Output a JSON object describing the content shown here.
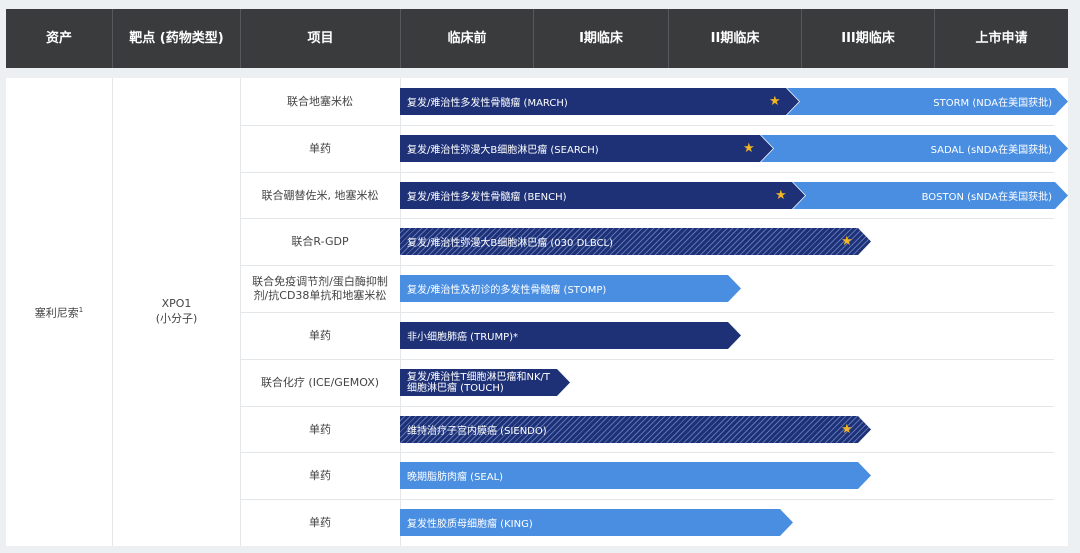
{
  "header": {
    "columns": [
      "资产",
      "靶点 (药物类型)",
      "项目",
      "临床前",
      "I期临床",
      "II期临床",
      "III期临床",
      "上市申请"
    ]
  },
  "asset": {
    "name": "塞利尼索",
    "footnote": "1"
  },
  "target": {
    "line1": "XPO1",
    "line2": "(小分子)"
  },
  "colors": {
    "header_bg": "#3a3b3d",
    "dark_bar": "#1e3177",
    "light_bar": "#4a8ee2",
    "star": "#f3b521"
  },
  "rows": [
    {
      "project": "联合地塞米松",
      "indication": "复发/难治性多发性骨髓瘤 (MARCH)",
      "style": "solid-dark",
      "star": true,
      "extension": "STORM (NDA在美国获批)"
    },
    {
      "project": "单药",
      "indication": "复发/难治性弥漫大B细胞淋巴瘤 (SEARCH)",
      "style": "solid-dark",
      "star": true,
      "extension": "SADAL (sNDA在美国获批)"
    },
    {
      "project": "联合硼替佐米, 地塞米松",
      "indication": "复发/难治性多发性骨髓瘤 (BENCH)",
      "style": "solid-dark",
      "star": true,
      "extension": "BOSTON (sNDA在美国获批)"
    },
    {
      "project": "联合R-GDP",
      "indication": "复发/难治性弥漫大B细胞淋巴瘤 (030 DLBCL)",
      "style": "hatched",
      "star": true
    },
    {
      "project": "联合免疫调节剂/蛋白酶抑制剂/抗CD38单抗和地塞米松",
      "indication": "复发/难治性及初诊的多发性骨髓瘤 (STOMP)",
      "style": "solid-light",
      "star": false
    },
    {
      "project": "单药",
      "indication": "非小细胞肺癌 (TRUMP)*",
      "style": "solid-dark",
      "star": false
    },
    {
      "project": "联合化疗 (ICE/GEMOX)",
      "indication": "复发/难治性T细胞淋巴瘤和NK/T细胞淋巴瘤 (TOUCH)",
      "style": "solid-dark",
      "star": false
    },
    {
      "project": "单药",
      "indication": "维持治疗子宫内膜癌 (SIENDO)",
      "style": "hatched",
      "star": true
    },
    {
      "project": "单药",
      "indication": "晚期脂肪肉瘤 (SEAL)",
      "style": "solid-light",
      "star": false
    },
    {
      "project": "单药",
      "indication": "复发性胶质母细胞瘤 (KING)",
      "style": "solid-light",
      "star": false
    }
  ]
}
